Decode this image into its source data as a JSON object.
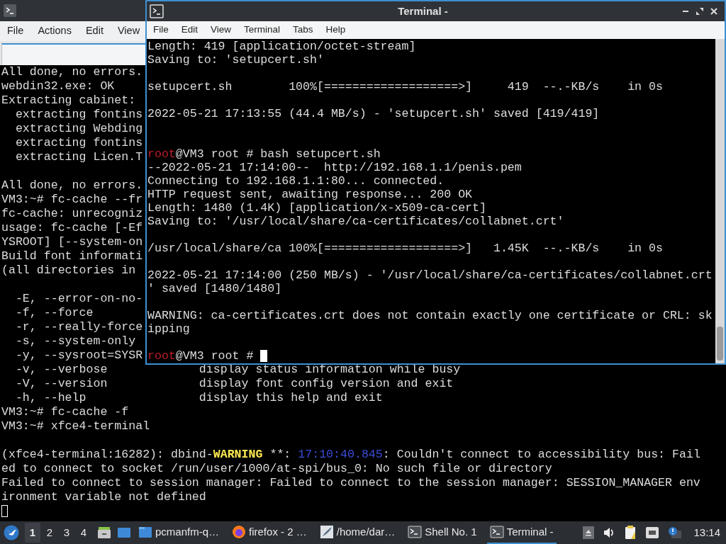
{
  "back_window": {
    "menu": [
      "File",
      "Actions",
      "Edit",
      "View"
    ],
    "lines": [
      {
        "text": "All done, no errors."
      },
      {
        "text": "webdin32.exe: OK"
      },
      {
        "text": "Extracting cabinet:"
      },
      {
        "text": "  extracting fontins"
      },
      {
        "text": "  extracting Webding"
      },
      {
        "text": "  extracting fontins"
      },
      {
        "text": "  extracting Licen.T"
      },
      {
        "kind": "blank"
      },
      {
        "text": "All done, no errors."
      },
      {
        "text": "VM3:~# fc-cache --fr"
      },
      {
        "text": "fc-cache: unrecogniz"
      },
      {
        "text": "usage: fc-cache [-Ef"
      },
      {
        "text": "YSROOT] [--system-on"
      },
      {
        "text": "Build font informati"
      },
      {
        "text": "(all directories in"
      },
      {
        "kind": "blank"
      },
      {
        "text": "  -E, --error-on-no-"
      },
      {
        "text": "  -f, --force"
      },
      {
        "text": "  -r, --really-force"
      },
      {
        "text": "  -s, --system-only"
      },
      {
        "text": "  -y, --sysroot=SYSR"
      },
      {
        "text": "  -v, --verbose             display status information while busy"
      },
      {
        "text": "  -V, --version             display font config version and exit"
      },
      {
        "text": "  -h, --help                display this help and exit"
      },
      {
        "text": "VM3:~# fc-cache -f"
      },
      {
        "text": "VM3:~# xfce4-terminal"
      },
      {
        "kind": "blank"
      },
      {
        "segments": [
          {
            "kind": "plain",
            "text": "(xfce4-terminal:16282): dbind-"
          },
          {
            "kind": "warning",
            "text": "WARNING"
          },
          {
            "kind": "plain",
            "text": " **: "
          },
          {
            "kind": "timestamp",
            "text": "17:10:40.845"
          },
          {
            "kind": "plain",
            "text": ": Couldn't connect to accessibility bus: Fail"
          }
        ]
      },
      {
        "text": "ed to connect to socket /run/user/1000/at-spi/bus_0: No such file or directory"
      },
      {
        "text": "Failed to connect to session manager: Failed to connect to the session manager: SESSION_MANAGER env"
      },
      {
        "text": "ironment variable not defined"
      },
      {
        "kind": "cursor",
        "focused": false
      }
    ]
  },
  "terminal_window": {
    "title": "Terminal -",
    "menu": [
      "File",
      "Edit",
      "View",
      "Terminal",
      "Tabs",
      "Help"
    ],
    "lines": [
      {
        "text": "Length: 419 [application/octet-stream]"
      },
      {
        "text": "Saving to: 'setupcert.sh'"
      },
      {
        "kind": "blank"
      },
      {
        "text": "setupcert.sh        100%[===================>]     419  --.-KB/s    in 0s"
      },
      {
        "kind": "blank"
      },
      {
        "text": "2022-05-21 17:13:55 (44.4 MB/s) - 'setupcert.sh' saved [419/419]"
      },
      {
        "kind": "blank"
      },
      {
        "kind": "blank"
      },
      {
        "segments": [
          {
            "kind": "user",
            "text": "root"
          },
          {
            "kind": "plain",
            "text": "@VM3 root # bash setupcert.sh"
          }
        ]
      },
      {
        "text": "--2022-05-21 17:14:00--  http://192.168.1.1/penis.pem"
      },
      {
        "text": "Connecting to 192.168.1.1:80... connected."
      },
      {
        "text": "HTTP request sent, awaiting response... 200 OK"
      },
      {
        "text": "Length: 1480 (1.4K) [application/x-x509-ca-cert]"
      },
      {
        "text": "Saving to: '/usr/local/share/ca-certificates/collabnet.crt'"
      },
      {
        "kind": "blank"
      },
      {
        "text": "/usr/local/share/ca 100%[===================>]   1.45K  --.-KB/s    in 0s"
      },
      {
        "kind": "blank"
      },
      {
        "text": "2022-05-21 17:14:00 (250 MB/s) - '/usr/local/share/ca-certificates/collabnet.crt"
      },
      {
        "text": "' saved [1480/1480]"
      },
      {
        "kind": "blank"
      },
      {
        "text": "WARNING: ca-certificates.crt does not contain exactly one certificate or CRL: sk"
      },
      {
        "text": "ipping"
      },
      {
        "kind": "blank"
      },
      {
        "segments": [
          {
            "kind": "user",
            "text": "root"
          },
          {
            "kind": "plain",
            "text": "@VM3 root # "
          }
        ],
        "cursor": true
      }
    ]
  },
  "taskbar": {
    "workspaces": [
      {
        "label": "1",
        "selected": true
      },
      {
        "label": "2",
        "selected": false
      },
      {
        "label": "3",
        "selected": false
      },
      {
        "label": "4",
        "selected": false
      }
    ],
    "tasks": [
      {
        "label": "pcmanfm-q…",
        "kind": "folder",
        "selected": false
      },
      {
        "label": "firefox - 2 …",
        "kind": "browser",
        "selected": false
      },
      {
        "label": "/home/dar…",
        "kind": "editor",
        "selected": false
      },
      {
        "label": "Shell No. 1",
        "kind": "terminal",
        "selected": false
      },
      {
        "label": "Terminal -",
        "kind": "terminal",
        "selected": true
      }
    ],
    "clock": "13:14"
  }
}
